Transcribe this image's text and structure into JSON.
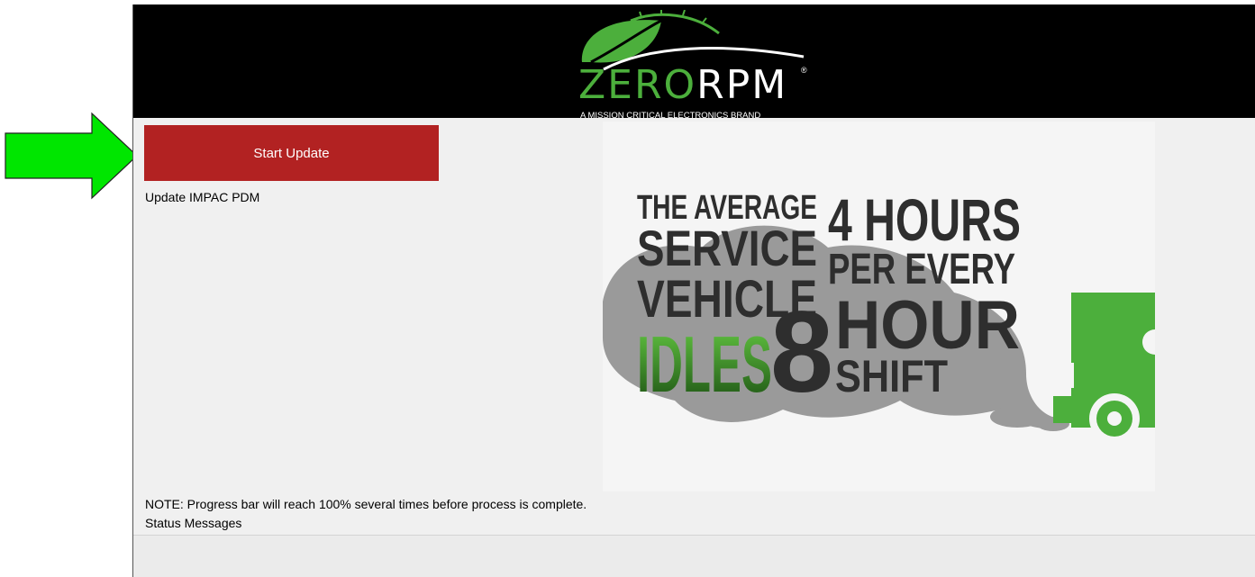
{
  "app": {
    "brand": {
      "name_zero": "ZERO",
      "name_rpm": "RPM",
      "registered": "®",
      "tagline": "A MISSION CRITICAL ELECTRONICS BRAND"
    },
    "actions": {
      "start_update_label": "Start Update",
      "update_target": "Update IMPAC PDM"
    },
    "banner": {
      "headline_left": [
        "THE AVERAGE",
        "SERVICE",
        "VEHICLE",
        "IDLES"
      ],
      "headline_right": [
        "4 HOURS",
        "PER EVERY",
        "8",
        "HOUR",
        "SHIFT"
      ]
    },
    "note": "NOTE: Progress bar will reach 100% several times before process is complete.",
    "status_label": "Status Messages"
  },
  "colors": {
    "header_bg": "#000000",
    "brand_green": "#4caf3c",
    "button_red": "#b22222",
    "pointer_green": "#00e600",
    "body_bg": "#f0f0f0",
    "smoke_gray": "#9a9a9a",
    "headline_dark": "#2e2e2e"
  },
  "icons": {
    "pointer": "right-arrow-icon",
    "logo_mark": "leaf-speedometer-icon",
    "truck": "service-truck-icon"
  }
}
